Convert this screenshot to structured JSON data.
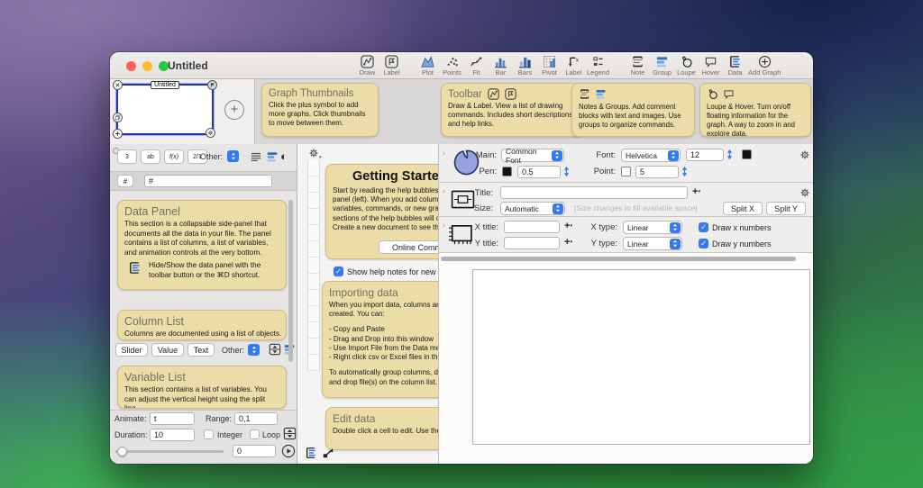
{
  "window": {
    "title": "Untitled"
  },
  "toolbar": {
    "items": [
      {
        "label": "Draw"
      },
      {
        "label": "Label"
      },
      {
        "label": "Plot"
      },
      {
        "label": "Points"
      },
      {
        "label": "Fit"
      },
      {
        "label": "Bar"
      },
      {
        "label": "Bars"
      },
      {
        "label": "Pivot"
      },
      {
        "label": "Label"
      },
      {
        "label": "Legend"
      },
      {
        "label": "Note"
      },
      {
        "label": "Group"
      },
      {
        "label": "Loupe"
      },
      {
        "label": "Hover"
      },
      {
        "label": "Data"
      },
      {
        "label": "Add Graph"
      }
    ]
  },
  "thumbnails": {
    "first_label": "Untitled"
  },
  "help_notes": {
    "graph_thumbnails": {
      "title": "Graph Thumbnails",
      "body": "Click the plus symbol to add more graphs. Click thumbnails to move between them."
    },
    "toolbar": {
      "title": "Toolbar",
      "body": "Draw & Label. View a list of drawing commands. Includes short descriptions and help links."
    },
    "notes_groups": {
      "body": "Notes & Groups. Add comment blocks with text and images. Use groups to organize commands."
    },
    "loupe_hover": {
      "body": "Loupe & Hover. Turn on/off floating information for the graph. A way to zoom in and explore data."
    }
  },
  "left_panel": {
    "type_buttons": [
      "3",
      "ab",
      "f(x)",
      "2/1"
    ],
    "other_label": "Other:",
    "hash_button": "#",
    "hash_column": "#",
    "data_panel_note": {
      "title": "Data Panel",
      "body": "This section is a collapsable side-panel that documents all the data in your file. The panel contains a list of columns, a list of variables, and animation controls at the very bottom.",
      "tip": "Hide/Show the data panel with the toolbar button or the ⌘D shortcut."
    },
    "column_list_note": {
      "title": "Column List",
      "body": "Columns are documented using a list of objects."
    },
    "column_buttons": {
      "slider": "Slider",
      "value": "Value",
      "text": "Text",
      "other_label": "Other:"
    },
    "variable_list_note": {
      "title": "Variable List",
      "body": "This section contains a list of variables. You can adjust the vertical height using the split line."
    },
    "animation": {
      "animate_label": "Animate:",
      "animate_value": "t",
      "range_label": "Range:",
      "range_value": "0,1",
      "duration_label": "Duration:",
      "duration_value": "10",
      "integer_label": "Integer",
      "loop_label": "Loop",
      "slider_value": "0"
    }
  },
  "middle": {
    "getting_started": {
      "title": "Getting Started",
      "body": "Start by reading the help bubbles in this panel (left).  When you add columns, variables, commands, or new graphs, sections of the help bubbles will open. Create a new document to see them.",
      "button": "Online Community"
    },
    "show_help_label": "Show help notes for new documents",
    "importing_data": {
      "title": "Importing data",
      "intro": "When you import data, columns are created. You can:",
      "lines": [
        "- Copy and Paste",
        "- Drag and Drop into this window",
        "- Use Import File from the Data menu",
        "- Right click csv or Excel files in the Finder"
      ],
      "outro": "To automatically group columns, drag and drop file(s) on the column list."
    },
    "edit_data": {
      "title": "Edit data",
      "body": "Double click a cell to edit. Use the tab key."
    }
  },
  "style_panel": {
    "main_label": "Main:",
    "main_value": "Common Font",
    "font_label": "Font:",
    "font_value": "Helvetica",
    "font_size": "12",
    "pen_label": "Pen:",
    "pen_value": "0.5",
    "point_label": "Point:",
    "point_value": "5",
    "title_label": "Title:",
    "title_value": "",
    "size_label": "Size:",
    "size_value": "Automatic",
    "size_hint": "[Size changes to fill available space]",
    "split_x": "Split X",
    "split_y": "Split Y",
    "x_title_label": "X title:",
    "y_title_label": "Y title:",
    "x_type_label": "X type:",
    "x_type_value": "Linear",
    "y_type_label": "Y type:",
    "y_type_value": "Linear",
    "draw_x_label": "Draw x numbers",
    "draw_y_label": "Draw y numbers"
  },
  "colors": {
    "accent": "#3478f6",
    "note_bg": "#ecdca8",
    "traffic_red": "#ff5f57",
    "traffic_yellow": "#febc2e",
    "traffic_green": "#28c840"
  }
}
